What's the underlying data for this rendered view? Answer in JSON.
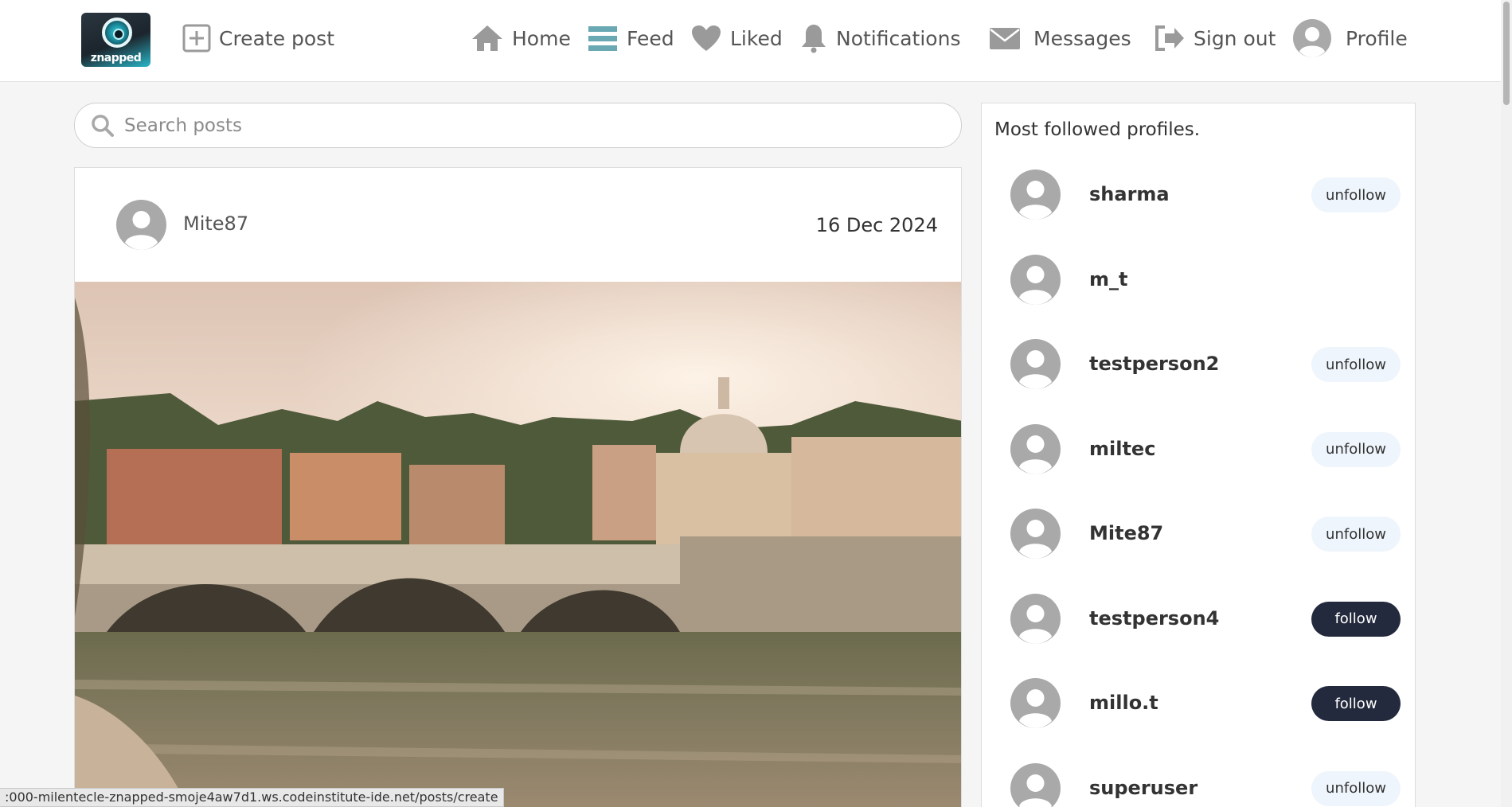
{
  "brand": {
    "logo_text": "znapped"
  },
  "nav": {
    "create_post": "Create post",
    "home": "Home",
    "feed": "Feed",
    "liked": "Liked",
    "notifications": "Notifications",
    "messages": "Messages",
    "sign_out": "Sign out",
    "profile": "Profile"
  },
  "search": {
    "placeholder": "Search posts",
    "value": ""
  },
  "post": {
    "owner": "Mite87",
    "date": "16 Dec 2024",
    "image_description_icon": "photo-rome-bridge"
  },
  "sidebar": {
    "title": "Most followed profiles.",
    "profiles": [
      {
        "username": "sharma",
        "action": "unfollow"
      },
      {
        "username": "m_t",
        "action": ""
      },
      {
        "username": "testperson2",
        "action": "unfollow"
      },
      {
        "username": "miltec",
        "action": "unfollow"
      },
      {
        "username": "Mite87",
        "action": "unfollow"
      },
      {
        "username": "testperson4",
        "action": "follow"
      },
      {
        "username": "millo.t",
        "action": "follow"
      },
      {
        "username": "superuser",
        "action": "unfollow"
      }
    ]
  },
  "status_bar": {
    "url": ":000-milentecle-znapped-smoje4aw7d1.ws.codeinstitute-ide.net/posts/create"
  },
  "colors": {
    "nav_icon": "#9a9a9a",
    "feed_icon": "#6aa8b4",
    "follow_bg": "#242a3d",
    "unfollow_bg": "#eef5fc"
  }
}
